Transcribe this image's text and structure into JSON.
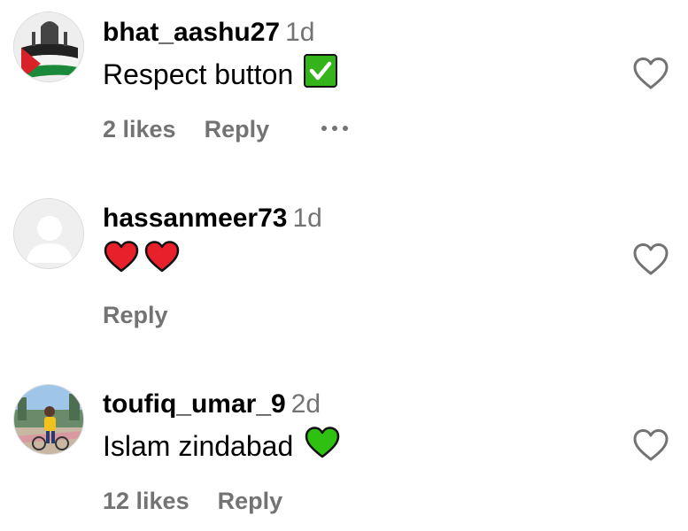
{
  "comments": [
    {
      "username": "bhat_aashu27",
      "time": "1d",
      "text": "Respect button",
      "emoji": "check-mark-button",
      "likes": "2 likes",
      "reply": "Reply",
      "avatar": "palestine-flag-avatar"
    },
    {
      "username": "hassanmeer73",
      "time": "1d",
      "text": "",
      "emoji": "two-red-hearts",
      "likes": "",
      "reply": "Reply",
      "avatar": "default-avatar"
    },
    {
      "username": "toufiq_umar_9",
      "time": "2d",
      "text": "Islam zindabad",
      "emoji": "green-heart",
      "likes": "12 likes",
      "reply": "Reply",
      "avatar": "photo-avatar"
    }
  ],
  "colors": {
    "secondary_text": "#737373",
    "check_green": "#35b31b",
    "heart_red": "#e8202b",
    "heart_green": "#2ec112"
  }
}
